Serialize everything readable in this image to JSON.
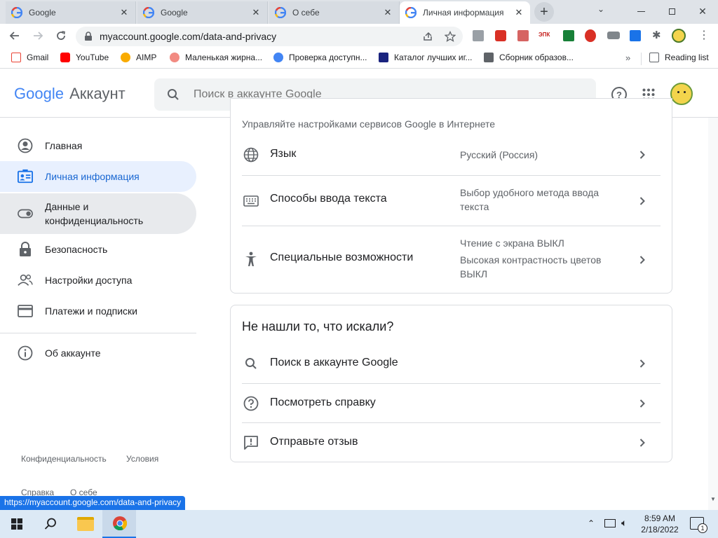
{
  "tabs": [
    {
      "title": "Google",
      "favicon": "google-icon"
    },
    {
      "title": "Google",
      "favicon": "google-icon"
    },
    {
      "title": "О себе",
      "favicon": "google-icon"
    },
    {
      "title": "Личная информация",
      "favicon": "google-icon"
    }
  ],
  "address": {
    "url": "myaccount.google.com/data-and-privacy"
  },
  "bookmarks": [
    {
      "label": "Gmail"
    },
    {
      "label": "YouTube"
    },
    {
      "label": "AIMP"
    },
    {
      "label": "Маленькая жирна..."
    },
    {
      "label": "Проверка доступн..."
    },
    {
      "label": "Каталог лучших иг..."
    },
    {
      "label": "Сборник образов..."
    }
  ],
  "reading_list": "Reading list",
  "header": {
    "logo_google": "Google",
    "logo_account": "Аккаунт",
    "search_placeholder": "Поиск в аккаунте Google"
  },
  "nav": [
    {
      "label": "Главная",
      "icon": "account-circle-icon"
    },
    {
      "label": "Личная информация",
      "icon": "id-card-icon",
      "active": true
    },
    {
      "label": "Данные и конфиденциальность",
      "icon": "toggle-icon",
      "hover": true
    },
    {
      "label": "Безопасность",
      "icon": "lock-icon"
    },
    {
      "label": "Настройки доступа",
      "icon": "people-icon"
    },
    {
      "label": "Платежи и подписки",
      "icon": "credit-card-icon"
    },
    {
      "label": "Об аккаунте",
      "icon": "info-icon"
    }
  ],
  "footer_links": [
    "Конфиденциальность",
    "Условия",
    "Справка",
    "О себе"
  ],
  "web_settings": {
    "subtitle": "Управляйте настройками сервисов Google в Интернете",
    "rows": [
      {
        "label": "Язык",
        "value": "Русский (Россия)",
        "icon": "globe-icon"
      },
      {
        "label": "Способы ввода текста",
        "value": "Выбор удобного метода ввода текста",
        "icon": "keyboard-icon"
      },
      {
        "label": "Специальные возможности",
        "value": "Чтение с экрана ВЫКЛ",
        "value2": "Высокая контрастность цветов ВЫКЛ",
        "icon": "accessibility-icon"
      }
    ]
  },
  "not_found": {
    "title": "Не нашли то, что искали?",
    "rows": [
      {
        "label": "Поиск в аккаунте Google",
        "icon": "search-icon"
      },
      {
        "label": "Посмотреть справку",
        "icon": "help-icon"
      },
      {
        "label": "Отправьте отзыв",
        "icon": "feedback-icon"
      }
    ]
  },
  "status_bar": "https://myaccount.google.com/data-and-privacy",
  "taskbar": {
    "time": "8:59 AM",
    "date": "2/18/2022",
    "notifications": "1"
  },
  "colors": {
    "accent": "#1a73e8",
    "active_bg": "#e8f0fe",
    "hover_bg": "#e8eaed"
  }
}
